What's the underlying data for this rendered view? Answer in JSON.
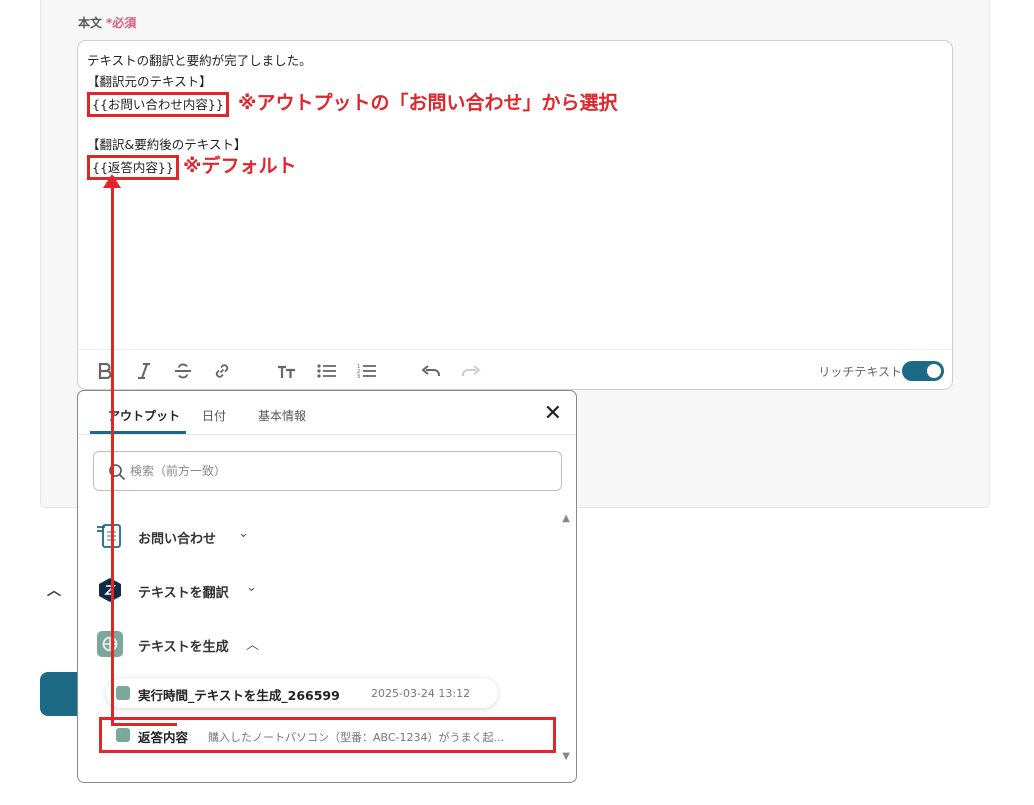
{
  "field": {
    "label": "本文",
    "required_mark": "*",
    "required_text": "必須"
  },
  "editor": {
    "lines": [
      "テキストの翻訳と要約が完了しました。",
      "【翻訳元のテキスト】",
      "{{お問い合わせ内容}}",
      "",
      "【翻訳&要約後のテキスト】",
      "{{返答内容}}"
    ],
    "rich_text_label": "リッチテキスト",
    "rich_text_enabled": true
  },
  "annotations": {
    "note1": "※アウトプットの「お問い合わせ」から選択",
    "note2": "※デフォルト"
  },
  "toolbar": {
    "icons": [
      "bold-icon",
      "italic-icon",
      "strikethrough-icon",
      "link-icon",
      "text-size-icon",
      "bullet-list-icon",
      "numbered-list-icon",
      "undo-icon",
      "redo-icon"
    ]
  },
  "popup": {
    "tabs": [
      "アウトプット",
      "日付",
      "基本情報"
    ],
    "active_tab": "アウトプット",
    "search_placeholder": "検索（前方一致）",
    "groups": [
      {
        "label": "お問い合わせ",
        "icon": "form-icon",
        "expanded": false
      },
      {
        "label": "テキストを翻訳",
        "icon": "translate-icon",
        "expanded": false
      },
      {
        "label": "テキストを生成",
        "icon": "ai-icon",
        "expanded": true
      }
    ],
    "items": [
      {
        "name": "実行時間_テキストを生成_266599",
        "value": "2025-03-24 13:12"
      },
      {
        "name": "返答内容",
        "value": "購入したノートパソコン（型番：ABC-1234）がうまく起..."
      }
    ]
  },
  "colors": {
    "accent": "#1c6a85",
    "annotation": "#e0262b",
    "required": "#e05a7a"
  }
}
